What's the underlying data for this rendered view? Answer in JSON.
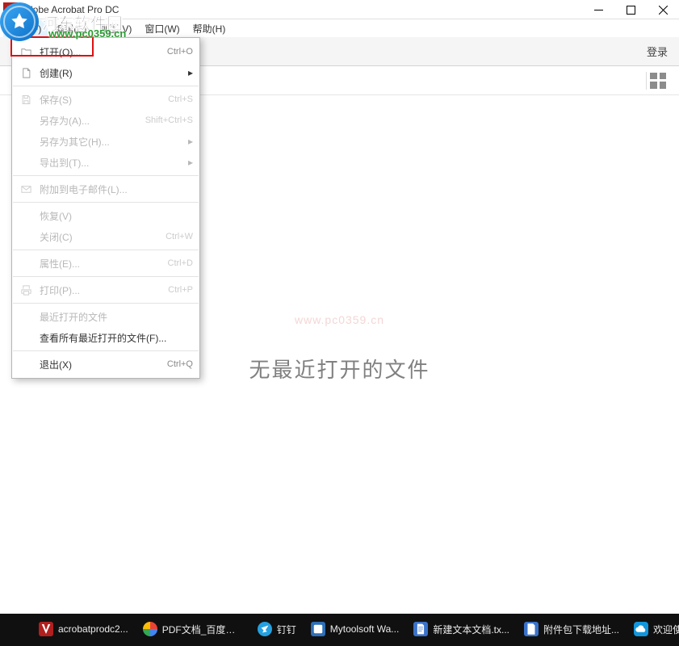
{
  "titlebar": {
    "title": "Adobe Acrobat Pro DC"
  },
  "menubar": {
    "items": [
      {
        "label": "文件(F)"
      },
      {
        "label": "编辑(E)"
      },
      {
        "label": "视图(V)"
      },
      {
        "label": "窗口(W)"
      },
      {
        "label": "帮助(H)"
      }
    ]
  },
  "watermark": {
    "brand": "河东软件园",
    "url": "www.pc0359.cn"
  },
  "toolbar": {
    "login": "登录"
  },
  "dropdown": {
    "open": {
      "label": "打开(O)...",
      "shortcut": "Ctrl+O"
    },
    "create": {
      "label": "创建(R)"
    },
    "save": {
      "label": "保存(S)",
      "shortcut": "Ctrl+S"
    },
    "save_as": {
      "label": "另存为(A)...",
      "shortcut": "Shift+Ctrl+S"
    },
    "save_other": {
      "label": "另存为其它(H)..."
    },
    "export": {
      "label": "导出到(T)..."
    },
    "attach_email": {
      "label": "附加到电子邮件(L)..."
    },
    "revert": {
      "label": "恢复(V)"
    },
    "close": {
      "label": "关闭(C)",
      "shortcut": "Ctrl+W"
    },
    "properties": {
      "label": "属性(E)...",
      "shortcut": "Ctrl+D"
    },
    "print": {
      "label": "打印(P)...",
      "shortcut": "Ctrl+P"
    },
    "recent": {
      "label": "最近打开的文件"
    },
    "view_all_recent": {
      "label": "查看所有最近打开的文件(F)..."
    },
    "exit": {
      "label": "退出(X)",
      "shortcut": "Ctrl+Q"
    }
  },
  "main": {
    "faint_watermark": "www.pc0359.cn",
    "empty_message": "无最近打开的文件"
  },
  "taskbar": {
    "items": [
      {
        "label": "acrobatprodc2...",
        "color": "#b11f1f"
      },
      {
        "label": "PDF文档_百度搜...",
        "color": "linear"
      },
      {
        "label": "钉钉",
        "color": "#25a0e0"
      },
      {
        "label": "Mytoolsoft Wa...",
        "color": "#2e6fb7"
      },
      {
        "label": "新建文本文档.tx...",
        "color": "#3a72c9"
      },
      {
        "label": "附件包下载地址...",
        "color": "#3a72c9"
      },
      {
        "label": "欢迎使用百",
        "color": "#1296db"
      }
    ]
  }
}
